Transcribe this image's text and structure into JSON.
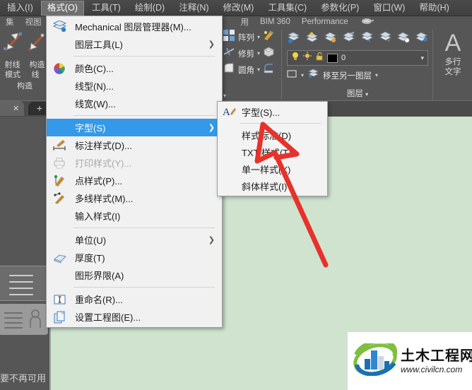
{
  "menubar": {
    "items": [
      {
        "label": "插入(I)",
        "active": false
      },
      {
        "label": "格式(O)",
        "active": true
      },
      {
        "label": "工具(T)",
        "active": false
      },
      {
        "label": "绘制(D)",
        "active": false
      },
      {
        "label": "注释(N)",
        "active": false
      },
      {
        "label": "修改(M)",
        "active": false
      },
      {
        "label": "工具集(C)",
        "active": false
      },
      {
        "label": "参数化(P)",
        "active": false
      },
      {
        "label": "窗口(W)",
        "active": false
      },
      {
        "label": "帮助(H)",
        "active": false
      }
    ]
  },
  "ribbon": {
    "tabs": [
      "集",
      "视图",
      "用",
      "BIM 360",
      "Performance"
    ],
    "draw_panel": {
      "label_ray": "射线",
      "label_mode": "模式",
      "label_construct_line_1": "构造",
      "label_construct_line_2": "线",
      "panel_title": "构造"
    },
    "modify_panel": {
      "array": "阵列",
      "trim": "修剪",
      "fillet": "圆角"
    },
    "layer_panel": {
      "current_layer": "0",
      "layer_color_swatch": "#000000",
      "move_to_layer": "移至另一图层",
      "panel_title": "图层"
    },
    "text_panel": {
      "glyph": "A",
      "line1": "多行",
      "line2": "文字"
    }
  },
  "tabstrip": {
    "close_label": "✕",
    "add_label": "+"
  },
  "statusbar": {
    "text": "要不再可用"
  },
  "format_menu": {
    "items": [
      {
        "label": "Mechanical 图层管理器(M)...",
        "icon": "layers-manager-icon",
        "submenu": false,
        "disabled": false,
        "highlighted": false,
        "separator_after": false
      },
      {
        "label": "图层工具(L)",
        "icon": "none",
        "submenu": true,
        "disabled": false,
        "highlighted": false,
        "separator_after": true
      },
      {
        "label": "颜色(C)...",
        "icon": "color-wheel-icon",
        "submenu": false,
        "disabled": false,
        "highlighted": false,
        "separator_after": false
      },
      {
        "label": "线型(N)...",
        "icon": "none",
        "submenu": false,
        "disabled": false,
        "highlighted": false,
        "separator_after": false
      },
      {
        "label": "线宽(W)...",
        "icon": "none",
        "submenu": false,
        "disabled": false,
        "highlighted": false,
        "separator_after": true
      },
      {
        "label": "字型(S)",
        "icon": "none",
        "submenu": true,
        "disabled": false,
        "highlighted": true,
        "separator_after": false
      },
      {
        "label": "标注样式(D)...",
        "icon": "dimension-style-icon",
        "submenu": false,
        "disabled": false,
        "highlighted": false,
        "separator_after": false
      },
      {
        "label": "打印样式(Y)...",
        "icon": "plot-style-icon",
        "submenu": false,
        "disabled": true,
        "highlighted": false,
        "separator_after": false
      },
      {
        "label": "点样式(P)...",
        "icon": "point-style-icon",
        "submenu": false,
        "disabled": false,
        "highlighted": false,
        "separator_after": false
      },
      {
        "label": "多线样式(M)...",
        "icon": "multiline-style-icon",
        "submenu": false,
        "disabled": false,
        "highlighted": false,
        "separator_after": false
      },
      {
        "label": "输入样式(I)",
        "icon": "none",
        "submenu": false,
        "disabled": false,
        "highlighted": false,
        "separator_after": true
      },
      {
        "label": "单位(U)",
        "icon": "none",
        "submenu": true,
        "disabled": false,
        "highlighted": false,
        "separator_after": false
      },
      {
        "label": "厚度(T)",
        "icon": "thickness-icon",
        "submenu": false,
        "disabled": false,
        "highlighted": false,
        "separator_after": false
      },
      {
        "label": "图形界限(A)",
        "icon": "none",
        "submenu": false,
        "disabled": false,
        "highlighted": false,
        "separator_after": true
      },
      {
        "label": "重命名(R)...",
        "icon": "rename-icon",
        "submenu": false,
        "disabled": false,
        "highlighted": false,
        "separator_after": false
      },
      {
        "label": "设置工程图(E)...",
        "icon": "drawing-setup-icon",
        "submenu": false,
        "disabled": false,
        "highlighted": false,
        "separator_after": false
      }
    ]
  },
  "text_style_submenu": {
    "items": [
      {
        "label": "字型(S)...",
        "icon": "text-style-icon",
        "separator_after": true
      },
      {
        "label": "样式标准(D)",
        "icon": "none",
        "separator_after": false
      },
      {
        "label": "TXT 样式(T)",
        "icon": "none",
        "separator_after": false
      },
      {
        "label": "单一样式(X)",
        "icon": "none",
        "separator_after": false
      },
      {
        "label": "斜体样式(I)",
        "icon": "none",
        "separator_after": false
      }
    ]
  },
  "annotation": {
    "arrow_color": "#e8312a"
  },
  "watermark": {
    "title": "土木工程网",
    "url": "www.civilcn.com"
  },
  "colors": {
    "canvas": "#cfe3cf",
    "chrome": "#565656",
    "menu_bg": "#f1f1f1",
    "highlight": "#3399e8"
  }
}
